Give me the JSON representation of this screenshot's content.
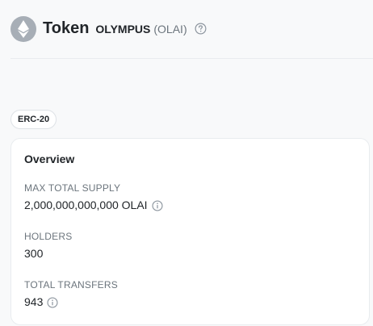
{
  "header": {
    "title": "Token",
    "token_name": "OLYMPUS",
    "token_symbol": "(OLAI)",
    "logo_icon": "ethereum-logo-icon",
    "help_icon": "question-circle-icon"
  },
  "badge": {
    "label": "ERC-20"
  },
  "overview": {
    "title": "Overview",
    "max_total_supply": {
      "label": "MAX TOTAL SUPPLY",
      "value": "2,000,000,000,000 OLAI",
      "icon": "info-icon"
    },
    "holders": {
      "label": "HOLDERS",
      "value": "300"
    },
    "total_transfers": {
      "label": "TOTAL TRANSFERS",
      "value": "943",
      "icon": "info-icon"
    }
  },
  "colors": {
    "background": "#f8f9fa",
    "card": "#ffffff",
    "muted_text": "#6c757d",
    "logo_bg": "#a7aeb6"
  }
}
